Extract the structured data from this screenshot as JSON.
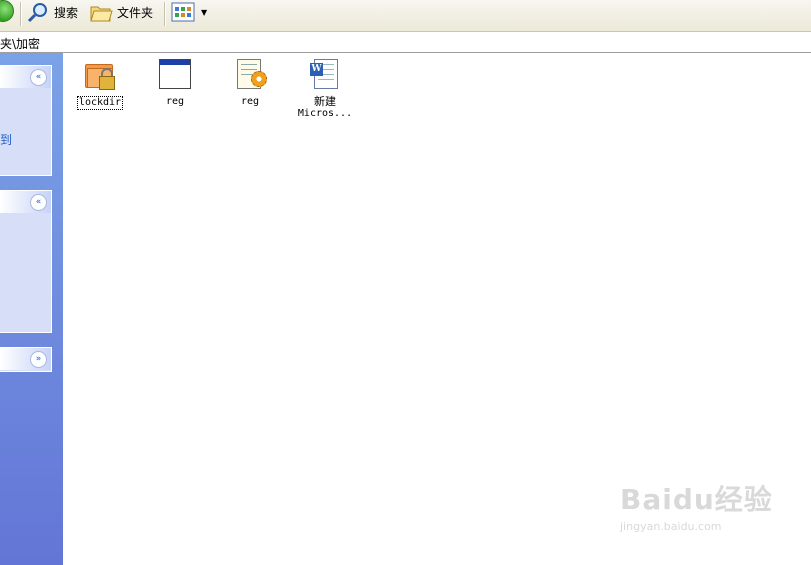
{
  "toolbar": {
    "search_label": "搜索",
    "folders_label": "文件夹",
    "icons": {
      "back": "back-arrow-icon",
      "search": "search-icon",
      "folders": "folders-icon",
      "views": "views-icon"
    }
  },
  "address": {
    "path": "夹\\加密"
  },
  "taskpane": {
    "panel1_text": "到",
    "panel1_chevron": "«",
    "panel2_chevron": "«",
    "panel3_chevron": "»"
  },
  "files": [
    {
      "name": "lockdir",
      "line2": "",
      "icon": "locked-folder-icon",
      "selected": true
    },
    {
      "name": "reg",
      "line2": "",
      "icon": "application-window-icon",
      "selected": false
    },
    {
      "name": "reg",
      "line2": "",
      "icon": "registry-file-icon",
      "selected": false
    },
    {
      "name": "新建",
      "line2": "Micros...",
      "icon": "word-document-icon",
      "selected": false
    }
  ],
  "watermark": {
    "brand": "Baidu经验",
    "url": "jingyan.baidu.com"
  },
  "colors": {
    "taskpane_top": "#7ba2e7",
    "taskpane_bottom": "#6375d6",
    "panel_bg": "#d6dff7",
    "link_blue": "#215dc6"
  }
}
